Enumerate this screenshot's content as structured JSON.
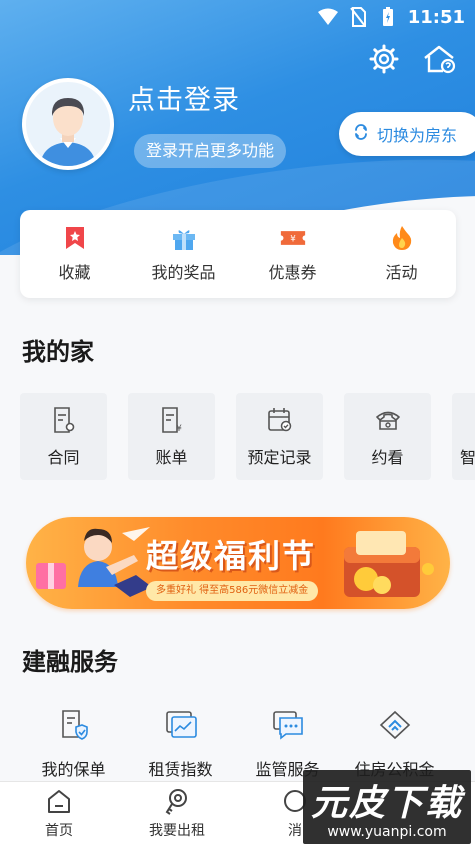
{
  "status_bar": {
    "time": "11:51"
  },
  "header": {
    "login_title": "点击登录",
    "login_sub": "登录开启更多功能",
    "switch_label": "切换为房东"
  },
  "quick_actions": [
    {
      "label": "收藏",
      "icon": "bookmark-icon",
      "color": "#f0464a"
    },
    {
      "label": "我的奖品",
      "icon": "gift-icon",
      "color": "#4fa7ef"
    },
    {
      "label": "优惠券",
      "icon": "coupon-icon",
      "color": "#f06a3a"
    },
    {
      "label": "活动",
      "icon": "flame-icon",
      "color": "#ff8a1a"
    }
  ],
  "my_home": {
    "title": "我的家",
    "items": [
      {
        "label": "合同",
        "icon": "contract-icon"
      },
      {
        "label": "账单",
        "icon": "bill-icon"
      },
      {
        "label": "预定记录",
        "icon": "calendar-icon"
      },
      {
        "label": "约看",
        "icon": "phone-icon"
      },
      {
        "label": "智",
        "icon": "smart-icon"
      }
    ]
  },
  "banner": {
    "title": "超级福利节",
    "subtitle": "多重好礼 得至高586元微信立减金"
  },
  "services": {
    "title": "建融服务",
    "items": [
      {
        "label": "我的保单",
        "icon": "policy-icon"
      },
      {
        "label": "租赁指数",
        "icon": "index-chart-icon"
      },
      {
        "label": "监管服务",
        "icon": "message-icon"
      },
      {
        "label": "住房公积金",
        "icon": "fund-icon"
      }
    ]
  },
  "tab_bar": [
    {
      "label": "首页",
      "icon": "home-icon"
    },
    {
      "label": "我要出租",
      "icon": "key-icon"
    },
    {
      "label": "消",
      "icon": "message-tab-icon"
    }
  ],
  "watermark": {
    "main": "元皮下载",
    "url": "www.yuanpi.com"
  },
  "colors": {
    "primary": "#2c8be0",
    "banner_orange": "#ff8a2a"
  }
}
